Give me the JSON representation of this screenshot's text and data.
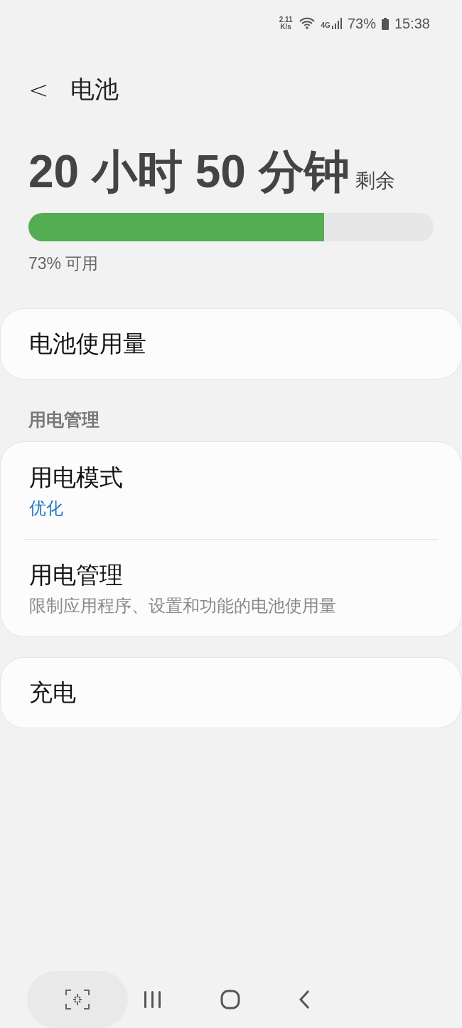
{
  "status_bar": {
    "speed": "2.11",
    "speed_unit": "K/s",
    "network": "4G",
    "battery": "73%",
    "time": "15:38"
  },
  "header": {
    "back": "<",
    "title": "电池"
  },
  "remaining": {
    "value": "20 小时 50 分钟",
    "suffix": "剩余"
  },
  "battery_bar": {
    "level": 0.73
  },
  "available": "73% 可用",
  "groups": [
    {
      "items": [
        {
          "title": "电池使用量"
        }
      ]
    },
    {
      "label": "用电管理",
      "items": [
        {
          "title": "用电模式",
          "subtitle": "优化",
          "kind": "value"
        },
        {
          "title": "用电管理",
          "subtitle": "限制应用程序、设置和功能的电池使用量",
          "kind": "description"
        }
      ]
    },
    {
      "items": [
        {
          "title": "充电"
        }
      ]
    }
  ]
}
